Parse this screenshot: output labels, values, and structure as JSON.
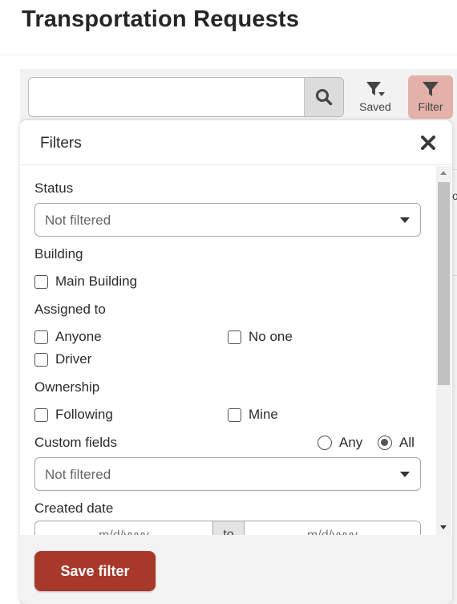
{
  "page": {
    "title": "Transportation Requests"
  },
  "toolbar": {
    "search": {
      "value": "",
      "placeholder": ""
    },
    "saved_label": "Saved",
    "filter_label": "Filter"
  },
  "background_table": {
    "clipped_text": "o"
  },
  "filters_panel": {
    "title": "Filters",
    "status": {
      "label": "Status",
      "selected": "Not filtered"
    },
    "building": {
      "label": "Building",
      "options": [
        "Main Building"
      ]
    },
    "assigned_to": {
      "label": "Assigned to",
      "options": [
        "Anyone",
        "No one",
        "Driver"
      ]
    },
    "ownership": {
      "label": "Ownership",
      "options": [
        "Following",
        "Mine"
      ]
    },
    "custom_fields": {
      "label": "Custom fields",
      "match_options": [
        "Any",
        "All"
      ],
      "match_selected": "All",
      "selected": "Not filtered"
    },
    "created_date": {
      "label": "Created date",
      "from_placeholder": "m/d/yyyy",
      "separator": "to",
      "to_placeholder": "m/d/yyyy"
    },
    "save_button_label": "Save filter"
  },
  "colors": {
    "primary_button": "#a8382a",
    "filter_button_active": "#e4b1aa"
  }
}
